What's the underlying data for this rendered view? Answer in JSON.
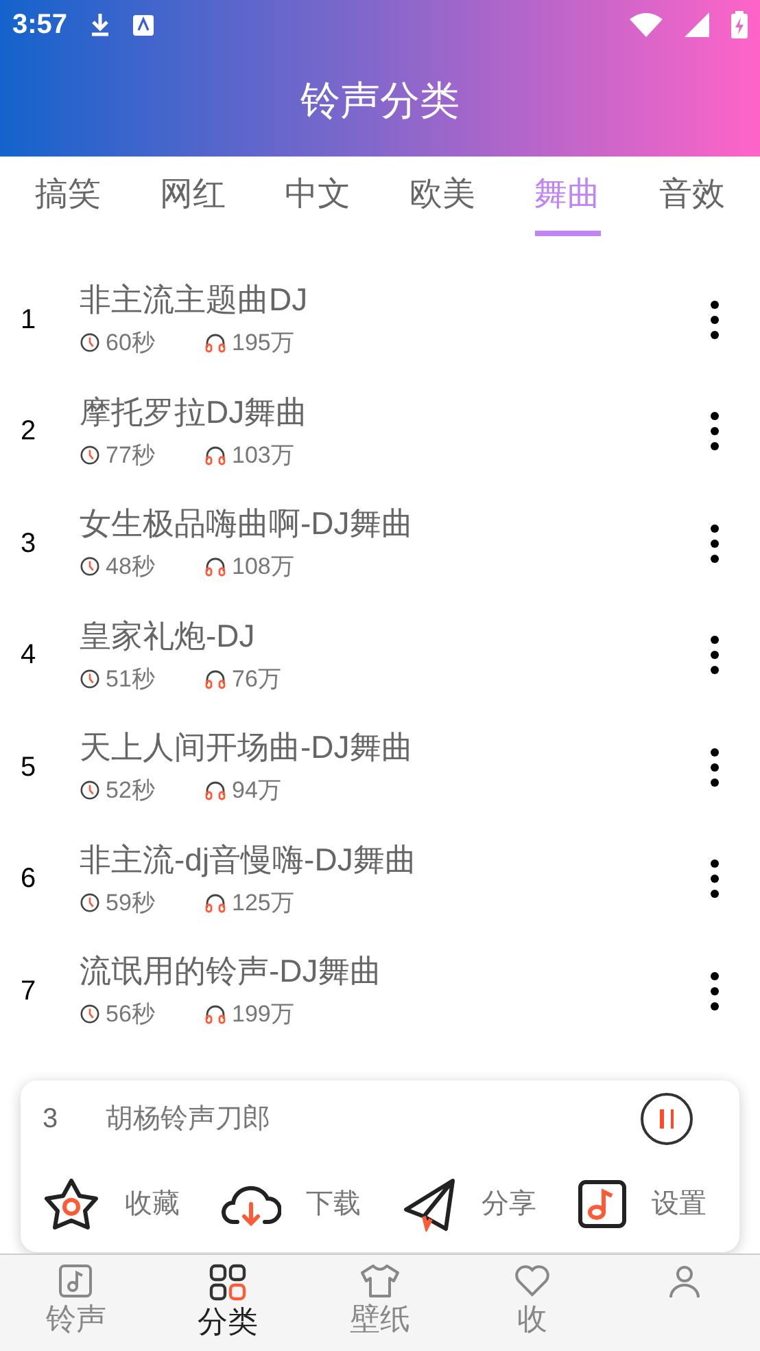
{
  "status_bar": {
    "time": "3:57"
  },
  "header": {
    "title": "铃声分类"
  },
  "tabs": [
    {
      "label": "搞笑",
      "selected": false
    },
    {
      "label": "网红",
      "selected": false
    },
    {
      "label": "中文",
      "selected": false
    },
    {
      "label": "欧美",
      "selected": false
    },
    {
      "label": "舞曲",
      "selected": true
    },
    {
      "label": "音效",
      "selected": false
    }
  ],
  "songs": [
    {
      "index": "1",
      "title": "非主流主题曲DJ",
      "duration": "60秒",
      "plays": "195万"
    },
    {
      "index": "2",
      "title": "摩托罗拉DJ舞曲",
      "duration": "77秒",
      "plays": "103万"
    },
    {
      "index": "3",
      "title": "女生极品嗨曲啊-DJ舞曲",
      "duration": "48秒",
      "plays": "108万"
    },
    {
      "index": "4",
      "title": "皇家礼炮-DJ",
      "duration": "51秒",
      "plays": "76万"
    },
    {
      "index": "5",
      "title": "天上人间开场曲-DJ舞曲",
      "duration": "52秒",
      "plays": "94万"
    },
    {
      "index": "6",
      "title": "非主流-dj音慢嗨-DJ舞曲",
      "duration": "59秒",
      "plays": "125万"
    },
    {
      "index": "7",
      "title": "流氓用的铃声-DJ舞曲",
      "duration": "56秒",
      "plays": "199万"
    }
  ],
  "player": {
    "index": "3",
    "title": "胡杨铃声刀郎",
    "playing": true,
    "actions": [
      {
        "kind": "favorite",
        "label": "收藏"
      },
      {
        "kind": "download",
        "label": "下载"
      },
      {
        "kind": "share",
        "label": "分享"
      },
      {
        "kind": "set",
        "label": "设置"
      }
    ]
  },
  "bottom_nav": [
    {
      "kind": "ringtone",
      "label": "铃声",
      "selected": false
    },
    {
      "kind": "category",
      "label": "分类",
      "selected": true
    },
    {
      "kind": "wallpaper",
      "label": "壁纸",
      "selected": false
    },
    {
      "kind": "favorite",
      "label": "收",
      "selected": false
    },
    {
      "kind": "profile",
      "selected": false
    }
  ]
}
